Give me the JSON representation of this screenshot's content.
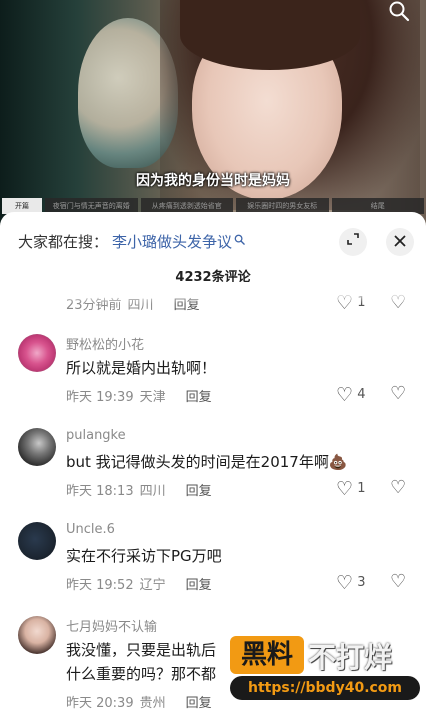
{
  "video": {
    "subtitle": "因为我的身份当时是妈妈",
    "search_icon": "search-icon",
    "chapters": [
      "开篇",
      "夜宿门与情无声音的离婚",
      "从疼痛到透剥透始省官",
      "娱乐圈时四的男女友标",
      "结尾"
    ]
  },
  "sheet": {
    "search_prefix": "大家都在搜：",
    "search_term": "李小璐做头发争议",
    "search_term_icon": "search-icon",
    "expand_icon": "expand-icon",
    "close_icon": "close-icon",
    "comment_count": "4232条评论"
  },
  "comments": [
    {
      "author": "",
      "text": "",
      "time": "23分钟前",
      "location": "四川",
      "reply": "回复",
      "likes": "1"
    },
    {
      "author": "野松松的小花",
      "text": "所以就是婚内出轨啊！",
      "time": "昨天 19:39",
      "location": "天津",
      "reply": "回复",
      "likes": "4"
    },
    {
      "author": "pulangke",
      "text": "but  我记得做头发的时间是在2017年啊💩",
      "time": "昨天 18:13",
      "location": "四川",
      "reply": "回复",
      "likes": "1"
    },
    {
      "author": "Uncle.6",
      "text": "实在不行采访下PG万吧",
      "time": "昨天 19:52",
      "location": "辽宁",
      "reply": "回复",
      "likes": "3"
    },
    {
      "author": "七月妈妈不认输",
      "text": "我没懂，只要是出轨后\n什么重要的吗？那不都",
      "time": "昨天 20:39",
      "location": "贵州",
      "reply": "回复",
      "likes": ""
    }
  ],
  "watermark": {
    "badge": "黑料",
    "big": "不打烊",
    "url": "https://bbdy40.com"
  },
  "colors": {
    "link_blue": "#3d64a8",
    "meta_gray": "#8a8a8a",
    "watermark_orange": "#f29a13"
  }
}
